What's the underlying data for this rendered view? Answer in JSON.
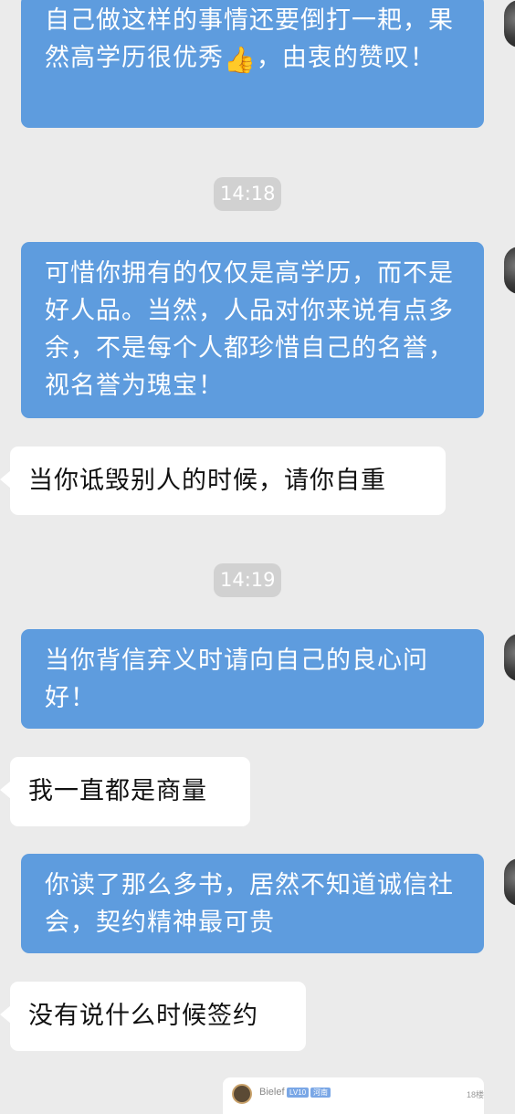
{
  "messages": [
    {
      "type": "out",
      "text": "自己做这样的事情还要倒打一耙，果然高学历很优秀",
      "emoji": "👍",
      "text_after": "，由衷的赞叹！"
    },
    {
      "type": "time",
      "text": "14:18"
    },
    {
      "type": "out",
      "text": "可惜你拥有的仅仅是高学历，而不是好人品。当然，人品对你来说有点多余，不是每个人都珍惜自己的名誉，视名誉为瑰宝！"
    },
    {
      "type": "in",
      "text": "当你诋毁别人的时候，请你自重"
    },
    {
      "type": "time",
      "text": "14:19"
    },
    {
      "type": "out",
      "text": "当你背信弃义时请向自己的良心问好！"
    },
    {
      "type": "in",
      "text": "我一直都是商量"
    },
    {
      "type": "out",
      "text": "你读了那么多书，居然不知道诚信社会，契约精神最可贵"
    },
    {
      "type": "in",
      "text": "没有说什么时候签约"
    }
  ],
  "bottom_card": {
    "name": "Bielef",
    "level_badge": "LV10",
    "second_badge": "河南",
    "count": "18楼"
  },
  "colors": {
    "outgoing_bubble": "#5e9cde",
    "incoming_bubble": "#ffffff",
    "background": "#ebebeb",
    "timestamp_pill": "#d1d1d1"
  }
}
